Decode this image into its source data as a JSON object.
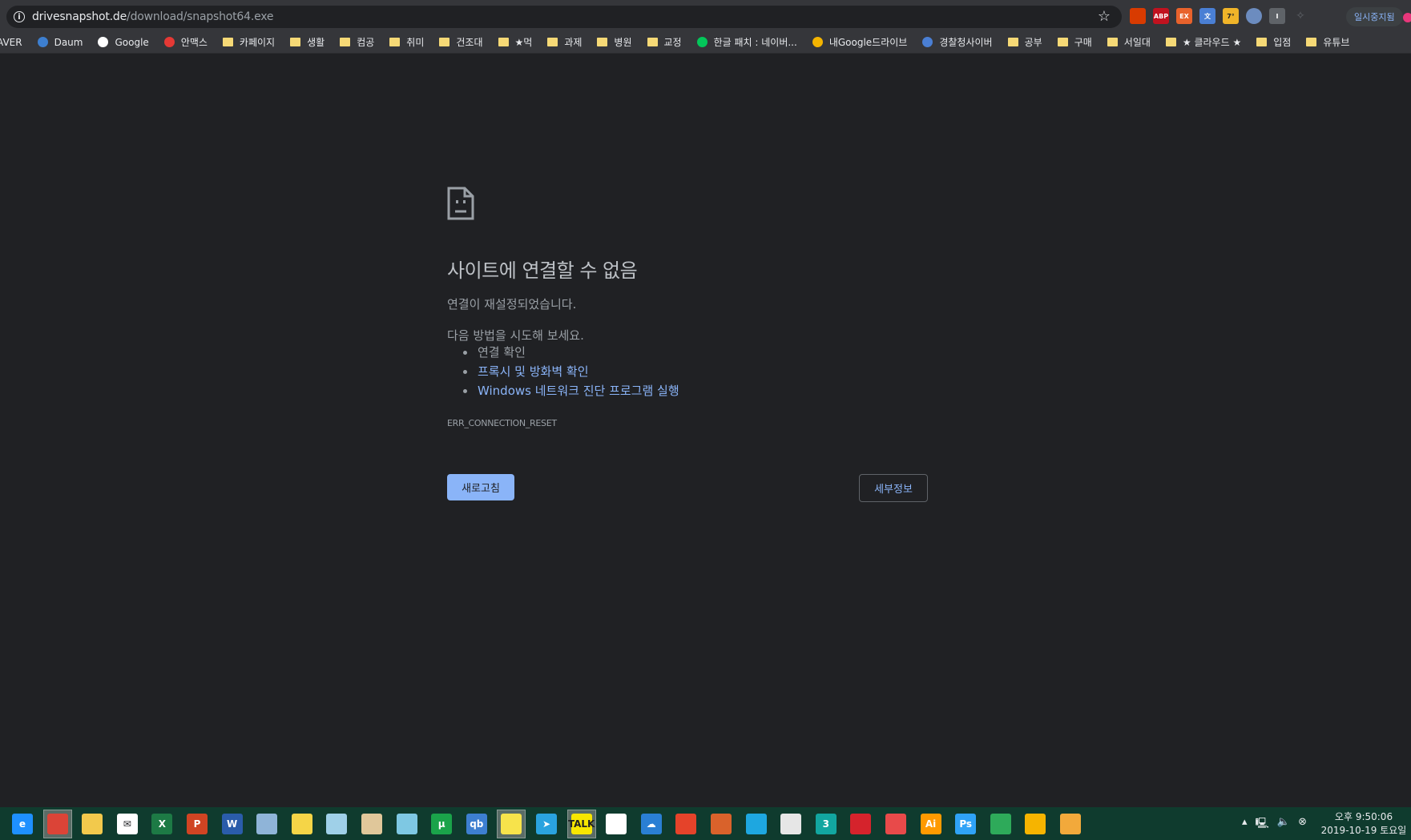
{
  "browser": {
    "url_host": "drivesnapshot.de",
    "url_path": "/download/snapshot64.exe",
    "pause_button_label": "일시중지됨",
    "extensions": [
      "office-icon",
      "abp-icon",
      "ex-icon",
      "translate-icon",
      "weather-icon",
      "colorzilla-icon",
      "ext-i-icon",
      "extensions-puzzle-icon"
    ],
    "ext_labels": {
      "abp": "ABP",
      "ex": "EX",
      "weather": "7°",
      "i": "I"
    }
  },
  "bookmarks": [
    {
      "label": "AVER",
      "icon": "naver-icon",
      "folder": false
    },
    {
      "label": "Daum",
      "icon": "daum-icon",
      "folder": false
    },
    {
      "label": "Google",
      "icon": "google-icon",
      "folder": false
    },
    {
      "label": "안맥스",
      "icon": "y-icon",
      "folder": false
    },
    {
      "label": "카페이지",
      "folder": true
    },
    {
      "label": "생활",
      "folder": true
    },
    {
      "label": "컴공",
      "folder": true
    },
    {
      "label": "취미",
      "folder": true
    },
    {
      "label": "건조대",
      "folder": true
    },
    {
      "label": "★먹",
      "folder": true
    },
    {
      "label": "과제",
      "folder": true
    },
    {
      "label": "병원",
      "folder": true
    },
    {
      "label": "교정",
      "folder": true
    },
    {
      "label": "한글 패치 : 네이버...",
      "icon": "naver-green-icon",
      "folder": false
    },
    {
      "label": "내Google드라이브",
      "icon": "drive-icon",
      "folder": false
    },
    {
      "label": "경찰청사이버",
      "icon": "police-icon",
      "folder": false
    },
    {
      "label": "공부",
      "folder": true
    },
    {
      "label": "구매",
      "folder": true
    },
    {
      "label": "서일대",
      "folder": true
    },
    {
      "label": "★ 클라우드 ★",
      "folder": true
    },
    {
      "label": "입점",
      "folder": true
    },
    {
      "label": "유튜브",
      "folder": true
    }
  ],
  "error": {
    "title": "사이트에 연결할 수 없음",
    "subtitle": "연결이 재설정되었습니다.",
    "try_label": "다음 방법을 시도해 보세요.",
    "suggestions": [
      {
        "text": "연결 확인",
        "link": false
      },
      {
        "text": "프록시 및 방화벽 확인",
        "link": true
      },
      {
        "text": "Windows 네트워크 진단 프로그램 실행",
        "link": true
      }
    ],
    "code": "ERR_CONNECTION_RESET",
    "reload_label": "새로고침",
    "details_label": "세부정보"
  },
  "taskbar": {
    "apps": [
      {
        "name": "edge-icon",
        "label": "e",
        "color": "#1e90ff"
      },
      {
        "name": "chrome-icon",
        "label": "",
        "color": "#db4437",
        "active": true
      },
      {
        "name": "file-explorer-icon",
        "label": "",
        "color": "#f2c94c"
      },
      {
        "name": "mail-icon",
        "label": "✉",
        "color": "#ffffff"
      },
      {
        "name": "excel-icon",
        "label": "X",
        "color": "#1d7a45"
      },
      {
        "name": "powerpoint-icon",
        "label": "P",
        "color": "#d04423"
      },
      {
        "name": "word-icon",
        "label": "W",
        "color": "#2a5caa"
      },
      {
        "name": "dictionary-icon",
        "label": "",
        "color": "#8fb4d8"
      },
      {
        "name": "notes-icon",
        "label": "",
        "color": "#f5d547"
      },
      {
        "name": "pen-app-icon",
        "label": "",
        "color": "#9fd0e8"
      },
      {
        "name": "book-icon",
        "label": "",
        "color": "#e0c79a"
      },
      {
        "name": "dropbox-like-icon",
        "label": "",
        "color": "#7ec8e3"
      },
      {
        "name": "utorrent-icon",
        "label": "μ",
        "color": "#1aa34a"
      },
      {
        "name": "qbittorrent-icon",
        "label": "qb",
        "color": "#3d7fd0"
      },
      {
        "name": "sticky-notes-icon",
        "label": "",
        "color": "#f7e34b",
        "active": true
      },
      {
        "name": "telegram-icon",
        "label": "➤",
        "color": "#2aa3df"
      },
      {
        "name": "kakaotalk-icon",
        "label": "TALK",
        "color": "#f7e600",
        "active": true
      },
      {
        "name": "clover-icon",
        "label": "",
        "color": "#ffffff"
      },
      {
        "name": "cloud-app-icon",
        "label": "☁",
        "color": "#2a7fd4"
      },
      {
        "name": "ccleaner-icon",
        "label": "",
        "color": "#e5432a"
      },
      {
        "name": "stripes-app-icon",
        "label": "",
        "color": "#d9622b"
      },
      {
        "name": "square-app-icon",
        "label": "",
        "color": "#1ea7e0"
      },
      {
        "name": "ring-app-icon",
        "label": "",
        "color": "#e6e6e6"
      },
      {
        "name": "3dsmax-icon",
        "label": "3",
        "color": "#12a6a0"
      },
      {
        "name": "acrobat-icon",
        "label": "",
        "color": "#d5232c"
      },
      {
        "name": "recorder-icon",
        "label": "",
        "color": "#e84a4a"
      },
      {
        "name": "illustrator-icon",
        "label": "Ai",
        "color": "#ff9a00"
      },
      {
        "name": "photoshop-icon",
        "label": "Ps",
        "color": "#2fa3f7"
      },
      {
        "name": "image-viewer-icon",
        "label": "",
        "color": "#2eaa5a"
      },
      {
        "name": "warning-app-icon",
        "label": "",
        "color": "#f6b400"
      },
      {
        "name": "pencil-app-icon",
        "label": "",
        "color": "#f2a93b"
      }
    ],
    "clock_time": "오후 9:50:06",
    "clock_date": "2019-10-19 토요일"
  }
}
